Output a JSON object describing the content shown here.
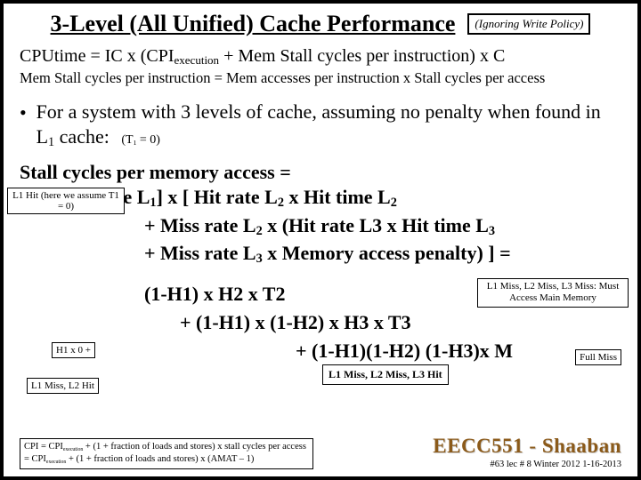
{
  "title": "3-Level (All Unified) Cache Performance",
  "note": "(Ignoring Write Policy)",
  "eq1_pre": "CPUtime  =  IC x   (CPI",
  "eq1_sub": "execution",
  "eq1_post": "  +  Mem Stall  cycles per instruction)    x   C",
  "eq2": "Mem Stall cycles per instruction =  Mem accesses per instruction  x  Stall cycles per access",
  "bullet_main": "For a system with 3 levels of cache, assuming no penalty when found in L",
  "bullet_sub": "1",
  "bullet_tail": " cache:",
  "bullet_trailer_pre": "(T",
  "bullet_trailer_sub": "1",
  "bullet_trailer_post": " = 0)",
  "section": "Stall cycles per memory access =",
  "s1_a": "[miss rate L",
  "s1_b": "1",
  "s1_c": "] x  [ Hit rate L",
  "s1_d": "2",
  "s1_e": "  x Hit time L",
  "s1_f": "2",
  "s2_a": "+  Miss rate L",
  "s2_b": "2",
  "s2_c": " x  (Hit rate L3 x Hit time L",
  "s2_d": "3",
  "s3_a": "+  Miss rate L",
  "s3_b": "3",
  "s3_c": "  x  Memory access penalty) ]   =",
  "chip_l1hit": "L1 Hit (here we assume T1 = 0)",
  "chip_h1": "H1 x 0 +",
  "chip_l1m": "L1 Miss,  L2  Hit",
  "chip_l3r": "L1 Miss,  L2 Miss, L3 Miss: Must Access Main Memory",
  "chip_full": "Full Miss",
  "f1": "(1-H1) x H2 x T2",
  "f2": "+     (1-H1) x (1-H2) x H3 x T3",
  "f3": "+       (1-H1)(1-H2) (1-H3)x M",
  "chip_l1m2": "L1 Miss, L2 Miss,  L3  Hit",
  "cpi_l1_a": "CPI = CPI",
  "cpi_l1_b": "execution",
  "cpi_l1_c": "  +  (1 + fraction of loads and stores) x stall cycles per access",
  "cpi_l2_a": "     = CPI",
  "cpi_l2_b": "execution",
  "cpi_l2_c": "  +  (1 + fraction of loads and stores) x (AMAT – 1)",
  "eecc": "EECC551 - Shaaban",
  "lec": "#63  lec # 8   Winter 2012  1-16-2013"
}
